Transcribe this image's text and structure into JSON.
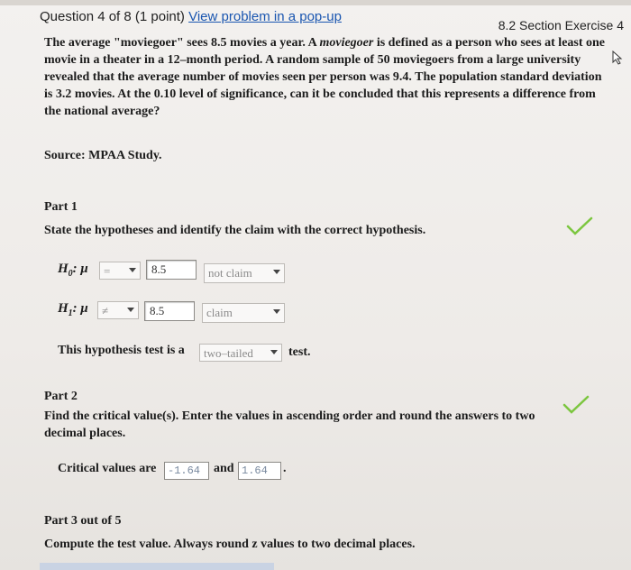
{
  "header": {
    "question_label": "Question 4 of 8 (1 point)",
    "popup_link": "View problem in a pop-up",
    "section": "8.2 Section Exercise 4"
  },
  "problem": {
    "p1": "The average \"moviegoer\" sees 8.5 movies a year. A ",
    "p1_italic": "moviegoer",
    "p2": " is defined as a person who sees at least one movie in a theater in a 12–month period. A random sample of 50 moviegoers from a large university revealed that the average number of movies seen per person was 9.4. The population standard deviation is 3.2 movies. At the 0.10 level of significance, can it be concluded that this represents a difference from the national average?",
    "source": "Source: MPAA Study."
  },
  "part1": {
    "title": "Part 1",
    "instruction": "State the hypotheses and identify the claim with the correct hypothesis.",
    "h0_label": "H",
    "h0_sub": "0",
    "h0_mu": ": μ",
    "h0_operator": "=",
    "h0_value": "8.5",
    "h0_claim": "not claim",
    "h1_label": "H",
    "h1_sub": "1",
    "h1_mu": ": μ",
    "h1_operator": "≠",
    "h1_value": "8.5",
    "h1_claim": "claim",
    "tail_prefix": "This hypothesis test is a",
    "tail_value": "two–tailed",
    "tail_suffix": "test."
  },
  "part2": {
    "title": "Part 2",
    "instruction": "Find the critical value(s). Enter the values in ascending order and round the answers to two decimal places.",
    "prefix": "Critical values are",
    "value1": "-1.64",
    "mid": "and",
    "value2": "1.64",
    "suffix": "."
  },
  "part3": {
    "title": "Part 3 out of 5",
    "instruction": "Compute the test value. Always round z values to two decimal places."
  },
  "colors": {
    "check": "#7cc63f",
    "link": "#1a56b0"
  }
}
